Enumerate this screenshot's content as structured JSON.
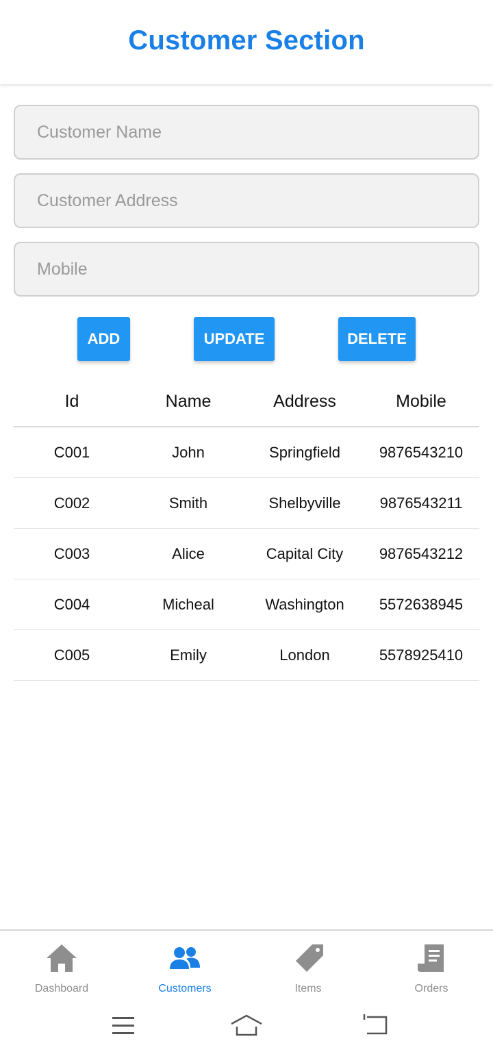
{
  "header": {
    "title": "Customer Section"
  },
  "form": {
    "name_placeholder": "Customer Name",
    "address_placeholder": "Customer Address",
    "mobile_placeholder": "Mobile"
  },
  "buttons": {
    "add": "ADD",
    "update": "UPDATE",
    "delete": "DELETE"
  },
  "table": {
    "headers": [
      "Id",
      "Name",
      "Address",
      "Mobile"
    ],
    "rows": [
      {
        "id": "C001",
        "name": "John",
        "address": "Springfield",
        "mobile": "9876543210"
      },
      {
        "id": "C002",
        "name": "Smith",
        "address": "Shelbyville",
        "mobile": "9876543211"
      },
      {
        "id": "C003",
        "name": "Alice",
        "address": "Capital City",
        "mobile": "9876543212"
      },
      {
        "id": "C004",
        "name": "Micheal",
        "address": "Washington",
        "mobile": "5572638945"
      },
      {
        "id": "C005",
        "name": "Emily",
        "address": "London",
        "mobile": "5578925410"
      }
    ]
  },
  "tabs": [
    {
      "label": "Dashboard",
      "icon": "home-icon",
      "active": false
    },
    {
      "label": "Customers",
      "icon": "people-icon",
      "active": true
    },
    {
      "label": "Items",
      "icon": "tag-icon",
      "active": false
    },
    {
      "label": "Orders",
      "icon": "receipt-icon",
      "active": false
    }
  ],
  "colors": {
    "accent": "#1a80e6",
    "button": "#2196f3",
    "inactive_tab": "#8e8e8e"
  }
}
